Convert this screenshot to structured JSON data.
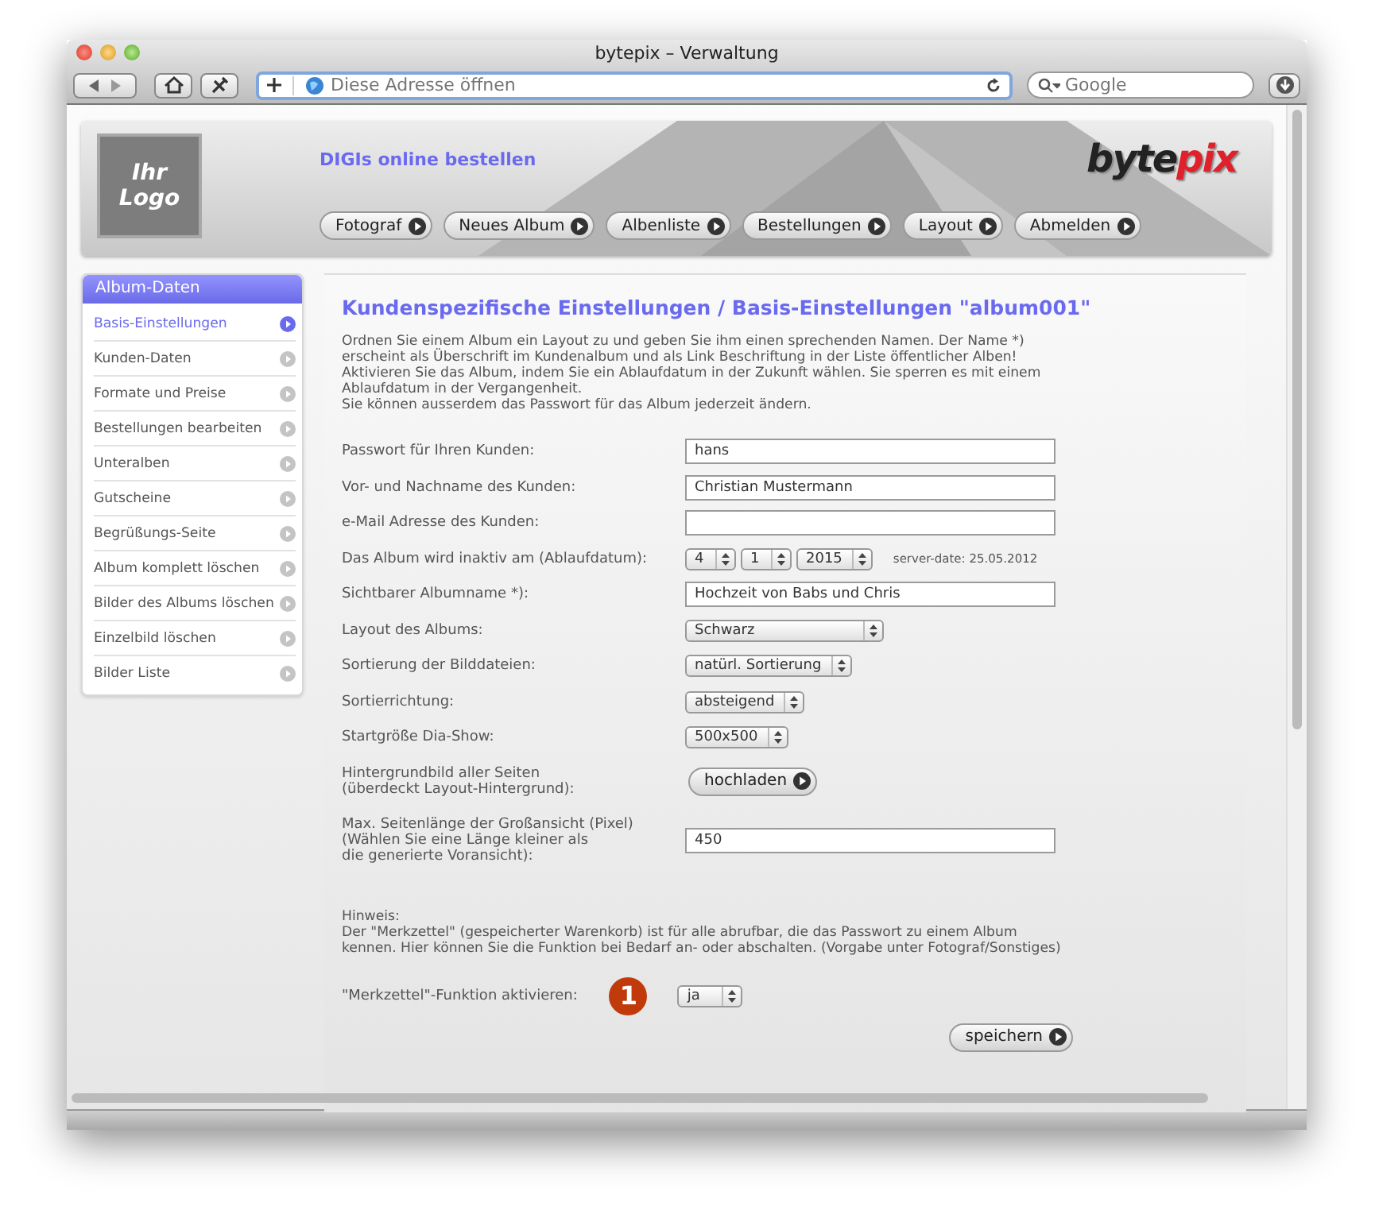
{
  "window": {
    "title": "bytepix – Verwaltung"
  },
  "toolbar": {
    "address_placeholder": "Diese Adresse öffnen",
    "search_placeholder": "Google"
  },
  "header": {
    "logo_lines": [
      "Ihr",
      "Logo"
    ],
    "tagline": "DIGIs online bestellen",
    "brand": [
      "byte",
      "pix"
    ],
    "nav": [
      "Fotograf",
      "Neues Album",
      "Albenliste",
      "Bestellungen",
      "Layout",
      "Abmelden"
    ]
  },
  "sidebar": {
    "title": "Album-Daten",
    "items": [
      {
        "label": "Basis-Einstellungen",
        "selected": true
      },
      {
        "label": "Kunden-Daten",
        "selected": false
      },
      {
        "label": "Formate und Preise",
        "selected": false
      },
      {
        "label": "Bestellungen bearbeiten",
        "selected": false
      },
      {
        "label": "Unteralben",
        "selected": false
      },
      {
        "label": "Gutscheine",
        "selected": false
      },
      {
        "label": "Begrüßungs-Seite",
        "selected": false
      },
      {
        "label": "Album komplett löschen",
        "selected": false
      },
      {
        "label": "Bilder des Albums löschen",
        "selected": false
      },
      {
        "label": "Einzelbild löschen",
        "selected": false
      },
      {
        "label": "Bilder Liste",
        "selected": false
      }
    ]
  },
  "content": {
    "title": "Kundenspezifische Einstellungen / Basis-Einstellungen \"album001\"",
    "intro": [
      "Ordnen Sie einem Album ein Layout zu und geben Sie ihm einen sprechenden Namen. Der Name *) erscheint als Überschrift im Kundenalbum und als Link Beschriftung in der Liste öffentlicher Alben!",
      "Aktivieren Sie das Album, indem Sie ein Ablaufdatum in der Zukunft wählen. Sie sperren es mit einem Ablaufdatum in der Vergangenheit.",
      "Sie können ausserdem das Passwort für das Album jederzeit ändern."
    ],
    "fields": [
      {
        "kind": "text",
        "label": "Passwort für Ihren Kunden:",
        "value": "hans"
      },
      {
        "kind": "text",
        "label": "Vor- und Nachname des Kunden:",
        "value": "Christian Mustermann"
      },
      {
        "kind": "text",
        "label": "e-Mail Adresse des Kunden:"
      },
      {
        "kind": "date",
        "label": "Das Album wird inaktiv am (Ablaufdatum):",
        "values": [
          "4",
          "1",
          "2015"
        ],
        "note": "server-date: 25.05.2012"
      },
      {
        "kind": "text",
        "label": "Sichtbarer Albumname *):",
        "value": "Hochzeit von Babs und Chris"
      },
      {
        "kind": "select",
        "label": "Layout des Albums:",
        "value": "Schwarz"
      },
      {
        "kind": "select",
        "label": "Sortierung der Bilddateien:",
        "value": "natürl. Sortierung"
      },
      {
        "kind": "select",
        "label": "Sortierrichtung:",
        "value": "absteigend"
      },
      {
        "kind": "select",
        "label": "Startgröße Dia-Show:",
        "value": "500x500"
      },
      {
        "kind": "upload",
        "label": "Hintergrundbild aller Seiten\n(überdeckt Layout-Hintergrund):",
        "button": "hochladen"
      },
      {
        "kind": "text",
        "label": "Max. Seitenlänge der Großansicht (Pixel)\n(Wählen Sie eine Länge kleiner als\ndie generierte Voransicht):",
        "value": "450"
      }
    ],
    "hint_title": "Hinweis:",
    "hint": "Der \"Merkzettel\" (gespeicherter Warenkorb) ist für alle abrufbar, die das Passwort zu einem Album kennen. Hier können Sie die Funktion bei Bedarf an- oder abschalten. (Vorgabe unter Fotograf/Sonstiges)",
    "merkzettel": {
      "label": "\"Merkzettel\"-Funktion aktivieren:",
      "marker": "1",
      "value": "ja"
    },
    "save": "speichern"
  }
}
